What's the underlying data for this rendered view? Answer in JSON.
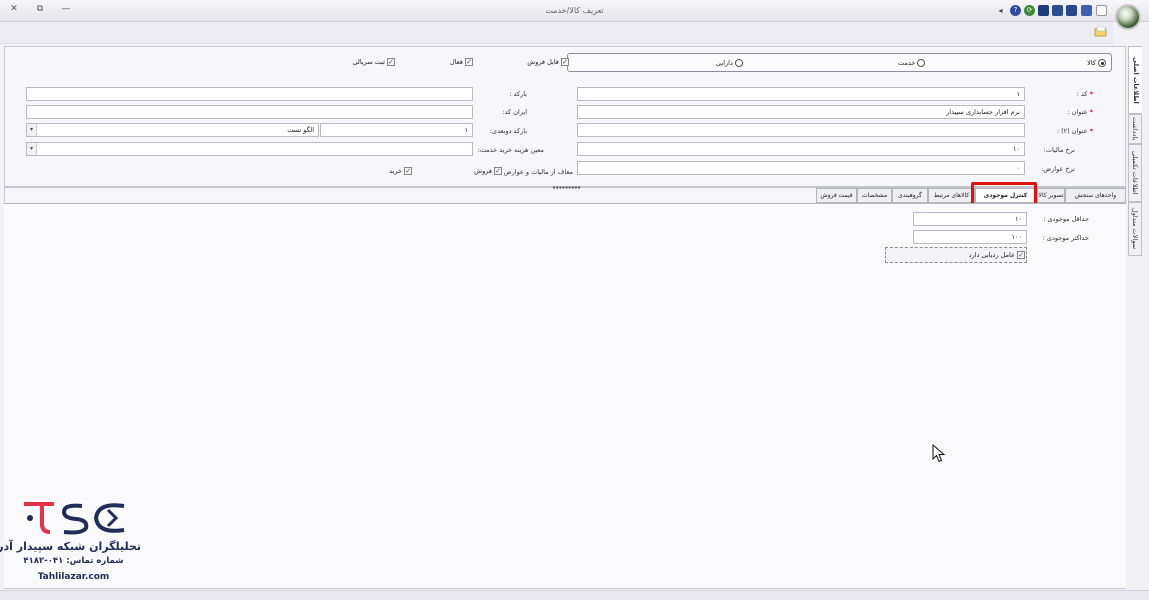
{
  "window": {
    "title": "تعریف کالا/خدمت",
    "close_glyph": "✕",
    "restore_glyph": "⧉",
    "minimize_glyph": "—"
  },
  "toolbar": {
    "back_icon": "◂",
    "help_icon": "?",
    "refresh_icon": "⟳"
  },
  "side_tabs": [
    {
      "label": "اطلاعات اصلی"
    },
    {
      "label": "یادداشت"
    },
    {
      "label": "اطلاعات تکمیلی"
    },
    {
      "label": "سوالات متداول"
    }
  ],
  "type_options": [
    {
      "label": "کالا",
      "selected": true
    },
    {
      "label": "خدمت",
      "selected": false
    },
    {
      "label": "دارایی",
      "selected": false
    }
  ],
  "flags_top": [
    {
      "label": "قابل فروش",
      "checked": true
    },
    {
      "label": "فعال",
      "checked": true
    },
    {
      "label": "ثبت سریالی",
      "checked": true
    }
  ],
  "fields": {
    "code": {
      "label": "کد :",
      "value": "۱"
    },
    "title": {
      "label": "عنوان :",
      "value": "نرم افزار حسابداری سپیدار"
    },
    "title2": {
      "label": "عنوان (۲) :",
      "value": ""
    },
    "tax_rate": {
      "label": "نرخ مالیات:",
      "value": "۱۰"
    },
    "duty_rate": {
      "label": "نرخ عوارض:",
      "value": "۰"
    },
    "barcode": {
      "label": "بارکد :",
      "value": ""
    },
    "iran_code": {
      "label": "ایران کد:",
      "value": ""
    },
    "barcode_2d": {
      "label": "بارکد دوبعدی:",
      "value": "۱",
      "pattern_value": "الگو تست"
    },
    "service_cost": {
      "label": "معین هزینه خرید خدمت:",
      "value": ""
    },
    "exempt": {
      "label": "معاف از مالیات و عوارض :"
    }
  },
  "exempt_flags": [
    {
      "label": "فروش",
      "checked": true
    },
    {
      "label": "خرید",
      "checked": true
    }
  ],
  "tabs": [
    {
      "label": "واحدهای سنجش",
      "active": false
    },
    {
      "label": "تصویر کالا",
      "active": false
    },
    {
      "label": "کنترل موجودی",
      "active": true
    },
    {
      "label": "کالاهای مرتبط",
      "active": false
    },
    {
      "label": "گروهبندی",
      "active": false
    },
    {
      "label": "مشخصات",
      "active": false
    },
    {
      "label": "قیمت فروش",
      "active": false
    }
  ],
  "inventory": {
    "min_label": "حداقل موجودی :",
    "min_value": "۱۰",
    "max_label": "حداکثر موجودی :",
    "max_value": "۱۰۰",
    "tracking_label": "عامل ردیابی دارد",
    "tracking_checked": true
  },
  "watermark": {
    "line1": "تحلیلگران شبکه سپیدار آذر",
    "line2": "شماره تماس: ۰۴۱-۴۱۸۲",
    "line3": "Tahlilazar.com"
  },
  "colors": {
    "highlight": "#e01010",
    "brand_red": "#e2324c",
    "brand_navy": "#1f2d58"
  }
}
